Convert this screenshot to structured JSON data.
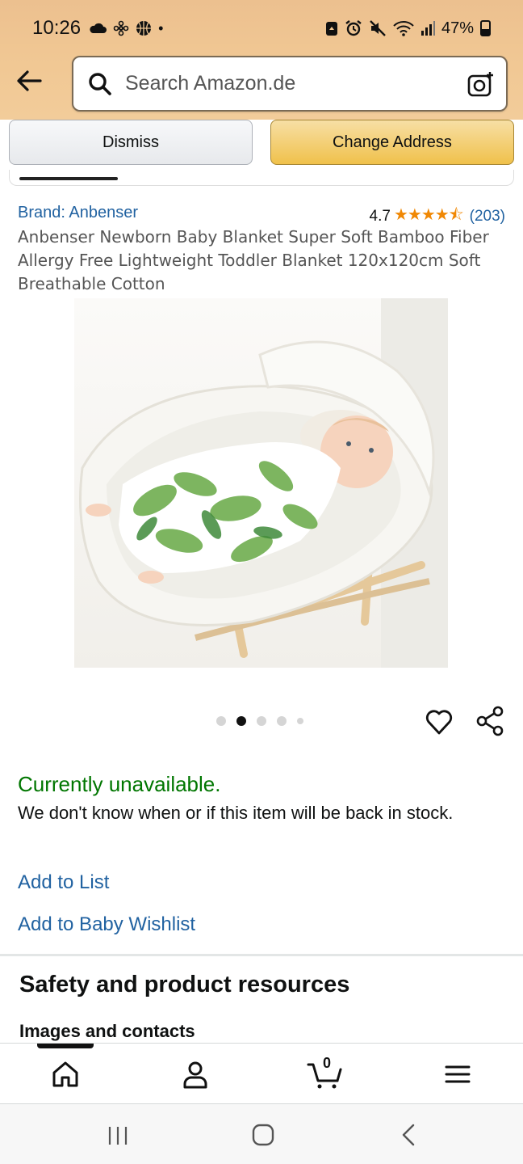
{
  "status_bar": {
    "time": "10:26",
    "battery": "47%"
  },
  "search": {
    "placeholder": "Search Amazon.de"
  },
  "address_banner": {
    "dismiss_label": "Dismiss",
    "change_label": "Change Address"
  },
  "product": {
    "brand": "Brand: Anbenser",
    "rating_value": "4.7",
    "rating_stars": "★★★★⯪",
    "rating_count": "(203)",
    "title": "Anbenser Newborn Baby Blanket Super Soft Bamboo Fiber Allergy Free Lightweight Toddler Blanket 120x120cm Soft Breathable Cotton",
    "image_count": 5,
    "active_image": 2
  },
  "availability": {
    "status": "Currently unavailable.",
    "message": "We don't know when or if this item will be back in stock."
  },
  "actions": {
    "add_to_list": "Add to List",
    "add_to_wishlist": "Add to Baby Wishlist"
  },
  "resources": {
    "title": "Safety and product resources",
    "subtitle": "Images and contacts"
  },
  "bottom_nav": {
    "cart_count": "0",
    "items": [
      "home-icon",
      "account-icon",
      "cart-icon",
      "menu-icon"
    ]
  },
  "colors": {
    "link": "#2162a1",
    "available_green": "#007600",
    "star": "#f08804",
    "header": "#f1c894"
  }
}
